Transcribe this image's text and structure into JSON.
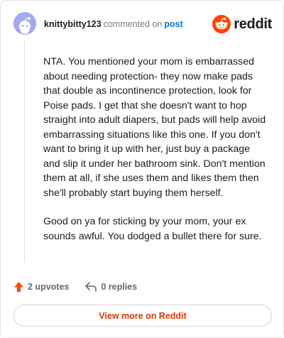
{
  "header": {
    "username": "knittybitty123",
    "action_text": "commented on",
    "post_link": "post",
    "brand_name": "reddit",
    "avatar_icon": "snoo-avatar-icon",
    "brand_icon": "reddit-logo-icon"
  },
  "comment": {
    "paragraphs": [
      "NTA. You mentioned your mom is embarrassed about needing protection- they now make pads that double as incontinence protection, look for Poise pads. I get that she doesn't want to hop straight into adult diapers, but pads will help avoid embarrassing situations like this one. If you don't want to bring it up with her, just buy a package and slip it under her bathroom sink. Don't mention them at all, if she uses them and likes them then she'll probably start buying them herself.",
      "Good on ya for sticking by your mom, your ex sounds awful. You dodged a bullet there for sure."
    ]
  },
  "actions": {
    "upvotes_label": "2 upvotes",
    "replies_label": "0 replies",
    "upvote_icon": "upvote-arrow-icon",
    "reply_icon": "reply-arrow-icon"
  },
  "footer": {
    "view_more_label": "View more on Reddit"
  },
  "colors": {
    "brand_orange": "#ff4500",
    "link_blue": "#0079d3",
    "muted_text": "#576f76",
    "view_more_text": "#d93a00",
    "avatar_bg": "#a3a8f0"
  }
}
